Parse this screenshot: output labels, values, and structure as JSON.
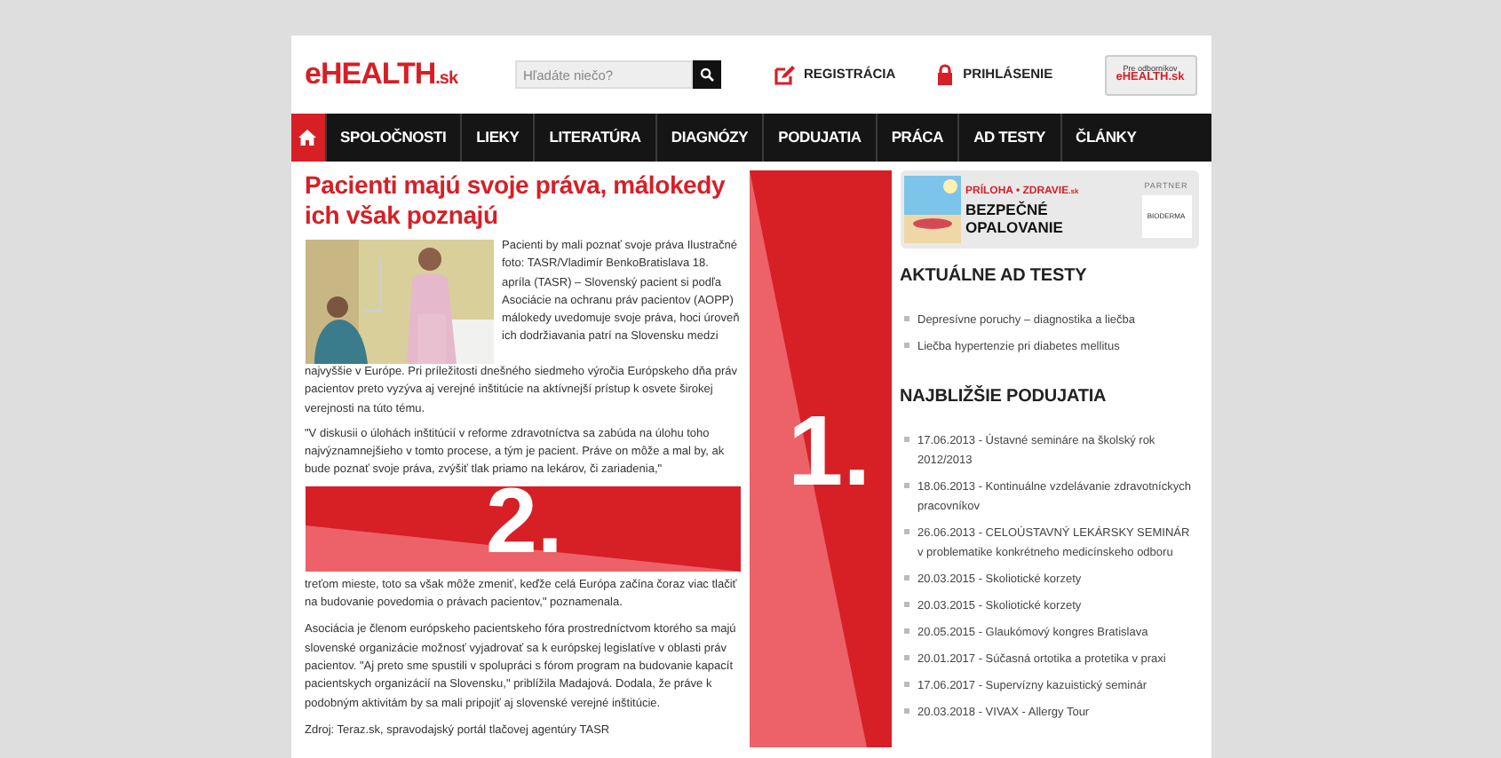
{
  "header": {
    "logo": "eHEALTH",
    "logo_suffix": ".sk",
    "search": {
      "placeholder": "Hľadáte niečo?"
    },
    "links": [
      {
        "label": "REGISTRÁCIA",
        "kind": "edit"
      },
      {
        "label": "PRIHLÁSENIE",
        "kind": "lock"
      }
    ],
    "pro_badge": {
      "line1": "Pre odborníkov",
      "line2": "eHEALTH.sk"
    }
  },
  "nav": [
    {
      "kind": "home",
      "selected": true
    },
    {
      "label": "SPOLOČNOSTI",
      "selected": false
    },
    {
      "label": "LIEKY",
      "selected": false
    },
    {
      "label": "LITERATÚRA",
      "selected": false
    },
    {
      "label": "DIAGNÓZY",
      "selected": false
    },
    {
      "label": "PODUJATIA",
      "selected": false
    },
    {
      "label": "PRÁCA",
      "selected": false
    },
    {
      "label": "AD TESTY",
      "selected": false
    },
    {
      "label": "ČLÁNKY",
      "selected": false
    }
  ],
  "article": {
    "title": "Pacienti majú svoje práva, málokedy ich však poznajú",
    "lead": "Pacienti by mali poznať svoje práva Ilustračné foto: TASR/Vladimír BenkoBratislava 18. apríla (TASR) – Slovenský pacient si podľa Asociácie na ochranu práv pacientov (AOPP) málokedy uvedomuje svoje práva, hoci úroveň ich dodržiavania patrí na Slovensku medzi",
    "lead_continued": "najvyššie v Európe. Pri príležitosti dnešného siedmeho výročia Európskeho dňa práv pacientov preto vyzýva aj verejné inštitúcie na aktívnejší prístup k osvete širokej verejnosti na túto tému.",
    "quote": "\"V diskusii o úlohách inštitúcií v reforme zdravotníctva sa zabúda na úlohu toho najvýznamnejšieho v tomto procese, a tým je pacient. Práve on môže a mal by, ak bude poznať svoje práva, zvýšiť tlak priamo na lekárov, či zariadenia,\"",
    "marker": "2.",
    "paragraphs": [
      "treťom mieste, toto sa však môže zmeniť, keďže celá Európa začína čoraz viac tlačiť na budovanie povedomia o právach pacientov,\" poznamenala.",
      "Asociácia je členom európskeho pacientskeho fóra prostredníctvom ktorého sa majú slovenské organizácie možnosť vyjadrovať sa k európskej legislatíve v oblasti práv pacientov. \"Aj preto sme spustili v spolupráci s fórom program na budovanie kapacít pacientskych organizácií na Slovensku,\" priblížila Madajová. Dodala, že práve k podobným aktivitám by sa mali pripojiť aj slovenské verejné inštitúcie.",
      "Zdroj: Teraz.sk, spravodajský portál tlačovej agentúry TASR"
    ]
  },
  "column_marker": "1.",
  "sidebar": {
    "banner": {
      "brand": "PRÍLOHA • ZDRAVIE",
      "brand_suffix": ".sk",
      "title": "BEZPEČNÉ OPALOVANIE",
      "partner": "PARTNER",
      "partner_logo": "BIODERMA"
    },
    "sections": [
      {
        "title": "AKTUÁLNE AD TESTY",
        "items": [
          "Depresívne poruchy – diagnostika a liečba",
          "Liečba hypertenzie pri diabetes mellitus"
        ]
      },
      {
        "title": "NAJBLIŽŠIE PODUJATIA",
        "items": [
          "17.06.2013 - Ústavné semináre na školský rok 2012/2013",
          "18.06.2013 - Kontinuálne vzdelávanie zdravotníckych pracovníkov",
          "26.06.2013 - CELOÚSTAVNÝ LEKÁRSKY SEMINÁR v problematike konkrétneho medicínskeho odboru",
          "20.03.2015 - Skoliotické korzety",
          "20.03.2015 - Skoliotické korzety",
          "20.05.2015 - Glaukómový kongres Bratislava",
          "20.01.2017 - Súčasná ortotika a protetika v praxi",
          "17.06.2017 - Supervízny kazuistický seminár",
          "20.03.2018 - VIVAX - Allergy Tour"
        ]
      }
    ]
  }
}
